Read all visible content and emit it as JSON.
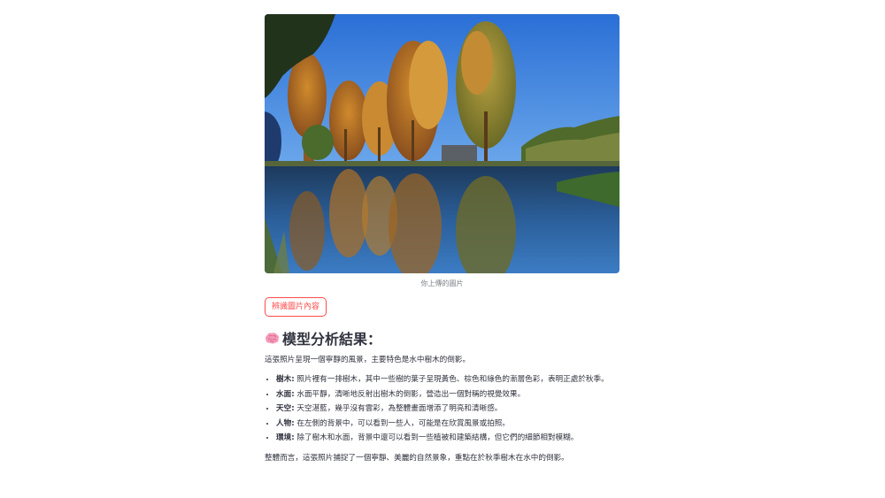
{
  "image": {
    "alt_icon": "photo-reflection-trees",
    "caption": "你上傳的圖片"
  },
  "actions": {
    "analyze_label": "辨識圖片內容"
  },
  "result": {
    "heading_icon": "brain-icon",
    "heading": "模型分析結果：",
    "intro": "這張照片呈現一個寧靜的風景，主要特色是水中樹木的倒影。",
    "items": [
      {
        "term": "樹木:",
        "text": " 照片裡有一排樹木，其中一些樹的葉子呈現黃色、棕色和綠色的漸層色彩，表明正處於秋季。"
      },
      {
        "term": "水面:",
        "text": " 水面平靜，清晰地反射出樹木的倒影，營造出一個對稱的視覺效果。"
      },
      {
        "term": "天空:",
        "text": " 天空湛藍，幾乎沒有雲彩，為整體畫面增添了明亮和清晰感。"
      },
      {
        "term": "人物:",
        "text": " 在左側的背景中，可以看到一些人，可能是在欣賞風景或拍照。"
      },
      {
        "term": "環境:",
        "text": " 除了樹木和水面，背景中還可以看到一些植被和建築結構，但它們的細節相對模糊。"
      }
    ],
    "summary": "整體而言，這張照片捕捉了一個寧靜、美麗的自然景象，重點在於秋季樹木在水中的倒影。"
  },
  "colors": {
    "accent": "#ff4b4b",
    "text": "#31333f",
    "caption": "#7d7f87"
  }
}
